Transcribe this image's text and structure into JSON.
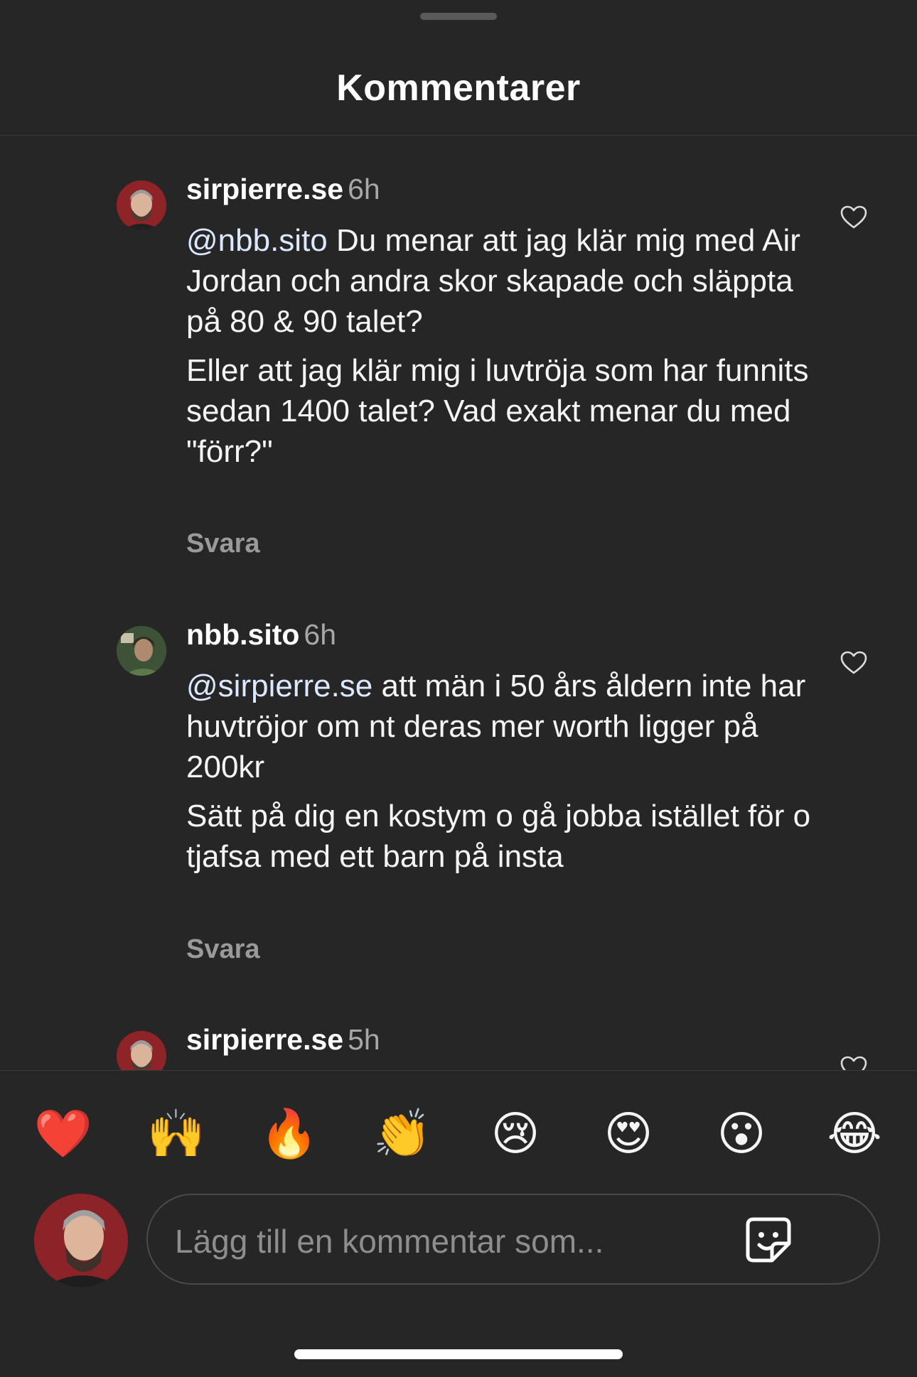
{
  "sheet": {
    "title": "Kommentarer"
  },
  "comments": [
    {
      "username": "sirpierre.se",
      "time": "6h",
      "mention": "@nbb.sito",
      "text_first": " Du menar att jag klär mig med Air Jordan och andra skor skapade och släppta på 80 & 90 talet?",
      "text_second": "Eller att jag klär mig i luvtröja som har funnits sedan 1400 talet? Vad exakt menar du med \"förr?\"",
      "reply_label": "Svara"
    },
    {
      "username": "nbb.sito",
      "time": "6h",
      "mention": "@sirpierre.se",
      "text_first": " att män i 50 års åldern inte har huvtröjor om nt deras mer worth ligger på 200kr",
      "text_second": "Sätt på dig en kostym o gå jobba istället för o tjafsa med ett barn på insta",
      "reply_label": "Svara"
    },
    {
      "username": "sirpierre.se",
      "time": "5h"
    }
  ],
  "reactions": [
    "❤️",
    "🙌",
    "🔥",
    "👏",
    "😢",
    "😍",
    "😮",
    "😂"
  ],
  "composer": {
    "placeholder": "Lägg till en kommentar som..."
  },
  "icons": {
    "like": "heart-outline-icon",
    "sticker": "sticker-icon"
  },
  "colors": {
    "background": "#262626",
    "mention": "#dbe8ff",
    "secondary_text": "#a8a8a8"
  }
}
